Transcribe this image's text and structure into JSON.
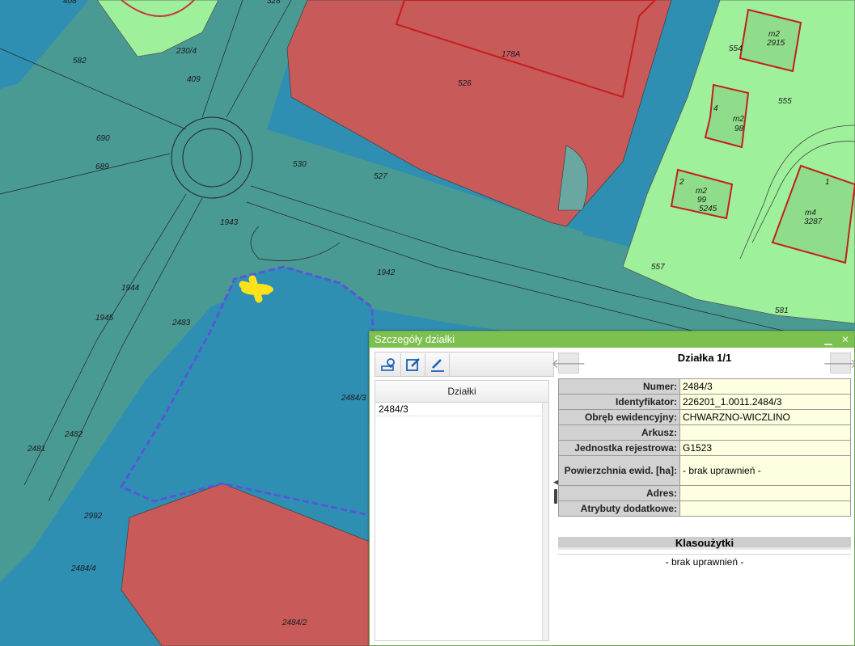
{
  "map": {
    "labels": [
      "408",
      "328",
      "230/4",
      "582",
      "409",
      "690",
      "689",
      "1943",
      "530",
      "527",
      "526",
      "178A",
      "1942",
      "1944",
      "1945",
      "2483",
      "2484/3",
      "2482",
      "2481",
      "2992",
      "2484/4",
      "2484/2",
      "554",
      "555",
      "m2",
      "2915",
      "m2",
      "98",
      "m2",
      "99",
      "5245",
      "m4",
      "3287",
      "557",
      "581",
      "4",
      "2",
      "1"
    ],
    "colors": {
      "water_blue": "#2f8fb3",
      "road_teal": "#4a9a94",
      "building_red": "#c85a5a",
      "residential_green": "#9ff09a",
      "selection_yellow": "#ffe21a",
      "selection_border": "#5558d6"
    }
  },
  "panel": {
    "title": "Szczegóły działki",
    "minimize_label": "▁",
    "close_label": "✕",
    "toolbar": {
      "locate_icon": "map-locate-icon",
      "edit_icon": "edit-form-icon",
      "pen_icon": "pen-icon"
    },
    "grid": {
      "column_header": "Działki",
      "rows": [
        "2484/3"
      ]
    },
    "record_title": "Działka 1/1",
    "nav_prev_label": "🡐",
    "nav_next_label": "🡒",
    "details": {
      "numer_label": "Numer:",
      "numer_value": "2484/3",
      "identyfikator_label": "Identyfikator:",
      "identyfikator_value": "226201_1.0011.2484/3",
      "obreb_label": "Obręb ewidencyjny:",
      "obreb_value": "CHWARZNO-WICZLINO",
      "arkusz_label": "Arkusz:",
      "arkusz_value": "",
      "jednostka_label": "Jednostka rejestrowa:",
      "jednostka_value": "G1523",
      "powierzchnia_label": "Powierzchnia ewid. [ha]:",
      "powierzchnia_value": "- brak uprawnień -",
      "adres_label": "Adres:",
      "adres_value": "",
      "atrybuty_label": "Atrybuty dodatkowe:",
      "atrybuty_value": ""
    },
    "klasouzytki": {
      "header": "Klasoużytki",
      "value": "- brak uprawnień -"
    }
  }
}
